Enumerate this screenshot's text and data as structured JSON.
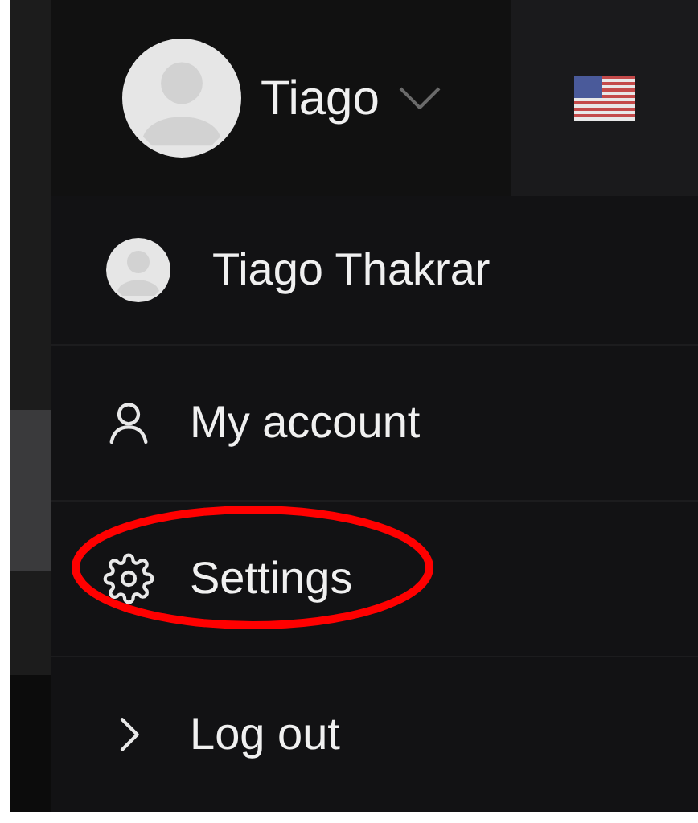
{
  "header": {
    "user_name": "Tiago"
  },
  "menu": {
    "profile_name": "Tiago Thakrar",
    "items": [
      {
        "kind": "account",
        "label": "My account",
        "circled": false
      },
      {
        "kind": "settings",
        "label": "Settings",
        "circled": true
      },
      {
        "kind": "logout",
        "label": "Log out",
        "circled": false
      }
    ]
  }
}
